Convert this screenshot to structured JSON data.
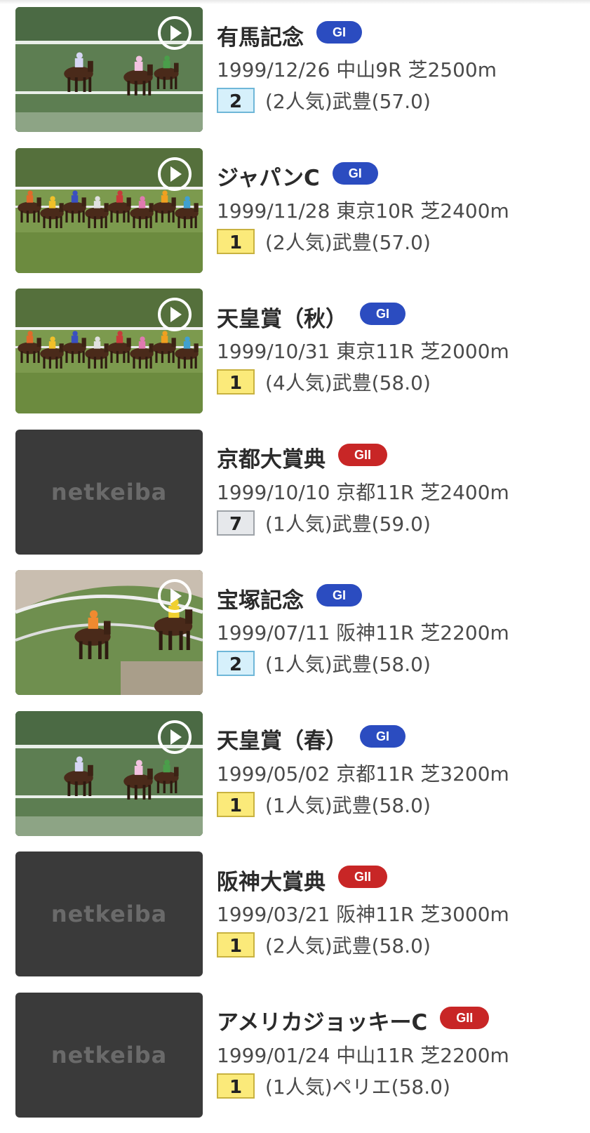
{
  "placeholder_logo": "netkeiba",
  "races": [
    {
      "name": "有馬記念",
      "grade": "GI",
      "grade_class": "g1",
      "date": "1999/12/26",
      "course": "中山9R",
      "distance": "芝2500m",
      "finish": "2",
      "popularity": "(2人気)",
      "jockey": "武豊(57.0)",
      "has_video": true,
      "scene": "stretch"
    },
    {
      "name": "ジャパンC",
      "grade": "GI",
      "grade_class": "g1",
      "date": "1999/11/28",
      "course": "東京10R",
      "distance": "芝2400m",
      "finish": "1",
      "popularity": "(2人気)",
      "jockey": "武豊(57.0)",
      "has_video": true,
      "scene": "pack"
    },
    {
      "name": "天皇賞（秋）",
      "grade": "GI",
      "grade_class": "g1",
      "date": "1999/10/31",
      "course": "東京11R",
      "distance": "芝2000m",
      "finish": "1",
      "popularity": "(4人気)",
      "jockey": "武豊(58.0)",
      "has_video": true,
      "scene": "pack"
    },
    {
      "name": "京都大賞典",
      "grade": "GII",
      "grade_class": "g2",
      "date": "1999/10/10",
      "course": "京都11R",
      "distance": "芝2400m",
      "finish": "7",
      "popularity": "(1人気)",
      "jockey": "武豊(59.0)",
      "has_video": false,
      "scene": "none"
    },
    {
      "name": "宝塚記念",
      "grade": "GI",
      "grade_class": "g1",
      "date": "1999/07/11",
      "course": "阪神11R",
      "distance": "芝2200m",
      "finish": "2",
      "popularity": "(1人気)",
      "jockey": "武豊(58.0)",
      "has_video": true,
      "scene": "turn"
    },
    {
      "name": "天皇賞（春）",
      "grade": "GI",
      "grade_class": "g1",
      "date": "1999/05/02",
      "course": "京都11R",
      "distance": "芝3200m",
      "finish": "1",
      "popularity": "(1人気)",
      "jockey": "武豊(58.0)",
      "has_video": true,
      "scene": "stretch"
    },
    {
      "name": "阪神大賞典",
      "grade": "GII",
      "grade_class": "g2",
      "date": "1999/03/21",
      "course": "阪神11R",
      "distance": "芝3000m",
      "finish": "1",
      "popularity": "(2人気)",
      "jockey": "武豊(58.0)",
      "has_video": false,
      "scene": "none"
    },
    {
      "name": "アメリカジョッキーC",
      "grade": "GII",
      "grade_class": "g2",
      "date": "1999/01/24",
      "course": "中山11R",
      "distance": "芝2200m",
      "finish": "1",
      "popularity": "(1人気)",
      "jockey": "ペリエ(58.0)",
      "has_video": false,
      "scene": "none"
    }
  ]
}
